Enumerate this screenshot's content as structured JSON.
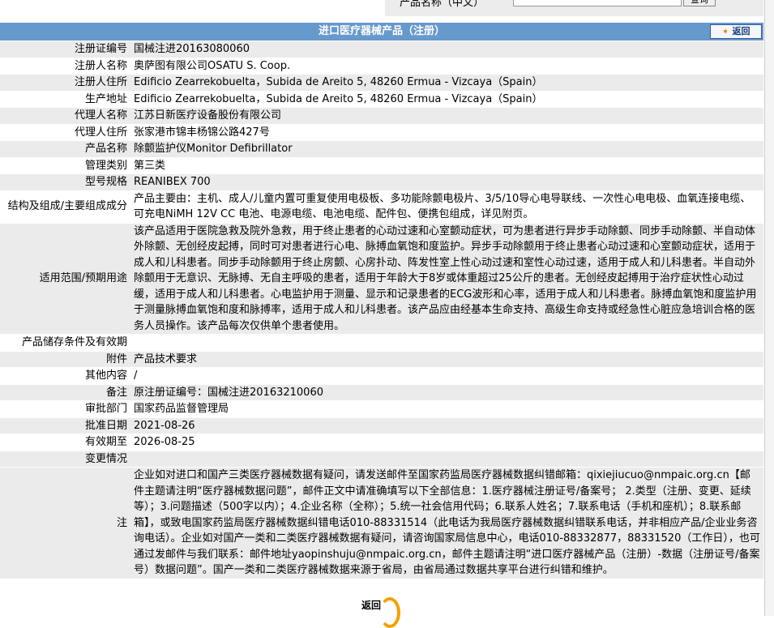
{
  "search": {
    "label": "产品名称（中文）",
    "button": "查询"
  },
  "header": {
    "title": "进口医疗器械产品（注册）",
    "back": "返回"
  },
  "rows": [
    {
      "k": "注册证编号",
      "v": "国械注进20163080060"
    },
    {
      "k": "注册人名称",
      "v": "奥萨图有限公司OSATU S. Coop."
    },
    {
      "k": "注册人住所",
      "v": "Edificio Zearrekobuelta，Subida de Areito 5, 48260 Ermua - Vizcaya（Spain）"
    },
    {
      "k": "生产地址",
      "v": "Edificio Zearrekobuelta，Subida de Areito 5, 48260 Ermua - Vizcaya（Spain）"
    },
    {
      "k": "代理人名称",
      "v": "江苏日新医疗设备股份有限公司"
    },
    {
      "k": "代理人住所",
      "v": "张家港市锦丰杨锦公路427号"
    },
    {
      "k": "产品名称",
      "v": "除颤监护仪Monitor Defibrillator"
    },
    {
      "k": "管理类别",
      "v": "第三类"
    },
    {
      "k": "型号规格",
      "v": "REANIBEX 700"
    },
    {
      "k": "结构及组成/主要组成成分",
      "v": "产品主要由：主机、成人/儿童内置可重复使用电极板、多功能除颤电极片、3/5/10导心电导联线、一次性心电电极、血氧连接电缆、可充电NiMH 12V CC 电池、电源电缆、电池电缆、配件包、便携包组成，详见附页。"
    },
    {
      "k": "适用范围/预期用途",
      "v": "该产品适用于医院急救及院外急救，用于终止患者的心动过速和心室颤动症状，可为患者进行异步手动除颤、同步手动除颤、半自动体外除颤、无创经皮起搏，同时可对患者进行心电、脉搏血氧饱和度监护。异步手动除颤用于终止患者心动过速和心室颤动症状，适用于成人和儿科患者。同步手动除颤用于终止房颤、心房扑动、阵发性室上性心动过速和室性心动过速，适用于成人和儿科患者。半自动外除颤用于无意识、无脉搏、无自主呼吸的患者，适用于年龄大于8岁或体重超过25公斤的患者。无创经皮起搏用于治疗症状性心动过缓，适用于成人和儿科患者。心电监护用于测量、显示和记录患者的ECG波形和心率，适用于成人和儿科患者。脉搏血氧饱和度监护用于测量脉搏血氧饱和度和脉搏率，适用于成人和儿科患者。该产品应由经基本生命支持、高级生命支持或经急性心脏应急培训合格的医务人员操作。该产品每次仅供单个患者使用。"
    },
    {
      "k": "产品储存条件及有效期",
      "v": ""
    },
    {
      "k": "附件",
      "v": "产品技术要求"
    },
    {
      "k": "其他内容",
      "v": "/"
    },
    {
      "k": "备注",
      "v": "原注册证编号：国械注进20163210060"
    },
    {
      "k": "审批部门",
      "v": "国家药品监督管理局"
    },
    {
      "k": "批准日期",
      "v": "2021-08-26"
    },
    {
      "k": "有效期至",
      "v": "2026-08-25"
    },
    {
      "k": "变更情况",
      "v": ""
    },
    {
      "k": "注",
      "v": "企业如对进口和国产三类医疗器械数据有疑问，请发送邮件至国家药监局医疗器械数据纠错邮箱：qixiejiucuo@nmpaic.org.cn【邮件主题请注明“医疗器械数据问题”，邮件正文中请准确填写以下全部信息：1.医疗器械注册证号/备案号； 2.类型（注册、变更、延续等）；3.问题描述（500字以内）；4.企业名称（全称）；5.统一社会信用代码；6.联系人姓名；7.联系电话（手机和座机）；8.联系邮箱】，或致电国家药监局医疗器械数据纠错电话010-88331514（此电话为我局医疗器械数据纠错联系电话，并非相应产品/企业业务咨询电话）。企业如对国产一类和二类医疗器械数据有疑问，请咨询国家局信息中心，电话010-88332877，88331520（工作日），也可通过发邮件与我们联系：邮件地址yaopinshuju@nmpaic.org.cn，邮件主题请注明“进口医疗器械产品（注册）-数据（注册证号/备案号）数据问题”。国产一类和二类医疗器械数据来源于省局，由省局通过数据共享平台进行纠错和维护。"
    }
  ],
  "footer": {
    "back": "返回"
  }
}
